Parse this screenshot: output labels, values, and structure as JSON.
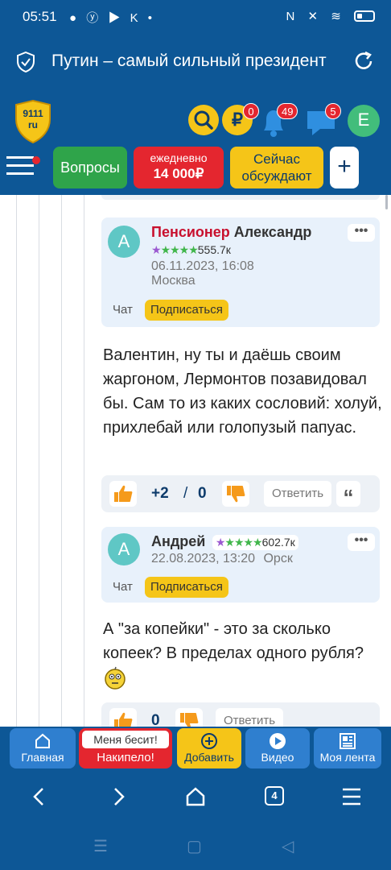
{
  "status_bar": {
    "time": "05:51",
    "left_icons": "● ⓨ ▶ K •",
    "right_icons": "N ✕ ≋"
  },
  "url_bar": {
    "title": "Путин – самый сильный президент"
  },
  "site_header": {
    "logo_line1": "9111",
    "logo_line2": "ru",
    "rub_symbol": "₽",
    "rub_badge": "0",
    "notifications_badge": "49",
    "messages_badge": "5",
    "profile_letter": "E",
    "nav": {
      "questions": "Вопросы",
      "daily_line1": "ежедневно",
      "daily_line2": "14 000₽",
      "now_line1": "Сейчас",
      "now_line2": "обсуждают",
      "plus": "+"
    }
  },
  "comments": [
    {
      "avatar_letter": "A",
      "name_red": "Пенсионер",
      "name_rest": "Александр",
      "rating": "555.7к",
      "date": "06.11.2023, 16:08",
      "city": "Москва",
      "chat_label": "Чат",
      "subscribe_label": "Подписаться",
      "text": "Валентин, ну ты и даёшь своим жаргоном, Лермонтов позавидовал бы. Сам то из каких сословий: холуй, прихлебай или голопузый папуас.",
      "score_plus": "+2",
      "score_sep": "/",
      "score_minus": "0",
      "reply_label": "Ответить",
      "quote": "“"
    },
    {
      "avatar_letter": "A",
      "name": "Андрей",
      "rating": "602.7к",
      "date": "22.08.2023, 13:20",
      "city": "Орск",
      "chat_label": "Чат",
      "subscribe_label": "Подписаться",
      "text": "А \"за копейки\" - это за сколько копеек? В пределах одного рубля?",
      "score_partial": "0",
      "reply_label": "Ответить"
    }
  ],
  "more_label": "•••",
  "bottom_bar": {
    "home": "Главная",
    "angry_top": "Меня бесит!",
    "angry_bottom": "Накипело!",
    "add": "Добавить",
    "video": "Видео",
    "feed": "Моя лента"
  },
  "browser_bar": {
    "tabs_count": "4"
  },
  "colors": {
    "brand_blue": "#0d5796",
    "accent_yellow": "#f5c518",
    "accent_red": "#e4262f",
    "accent_green": "#2fa44a"
  }
}
